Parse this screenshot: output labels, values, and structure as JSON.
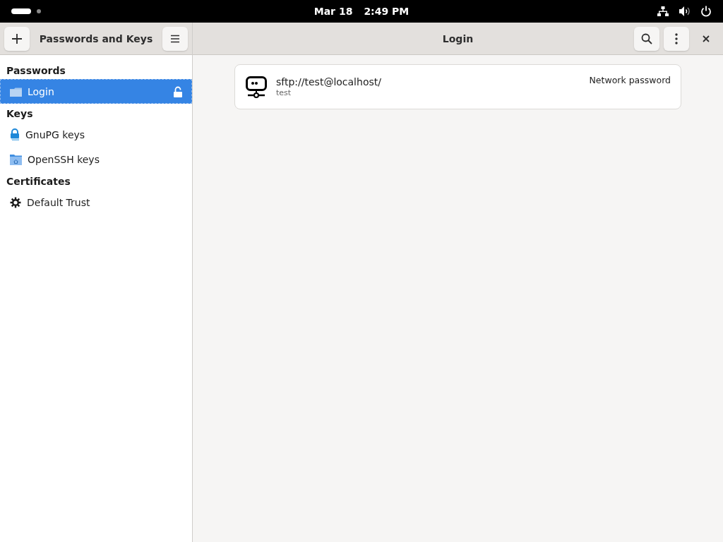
{
  "top_bar": {
    "date": "Mar 18",
    "time": "2:49 PM"
  },
  "sidebar": {
    "title": "Passwords and Keys",
    "sections": [
      {
        "heading": "Passwords",
        "items": [
          {
            "label": "Login",
            "kind": "folder",
            "selected": true,
            "locked": false
          }
        ]
      },
      {
        "heading": "Keys",
        "items": [
          {
            "label": "GnuPG keys",
            "kind": "gpg",
            "selected": false
          },
          {
            "label": "OpenSSH keys",
            "kind": "ssh",
            "selected": false
          }
        ]
      },
      {
        "heading": "Certificates",
        "items": [
          {
            "label": "Default Trust",
            "kind": "gear",
            "selected": false
          }
        ]
      }
    ]
  },
  "content": {
    "title": "Login",
    "entries": [
      {
        "name": "sftp://test@localhost/",
        "detail": "test",
        "type": "Network password"
      }
    ]
  }
}
